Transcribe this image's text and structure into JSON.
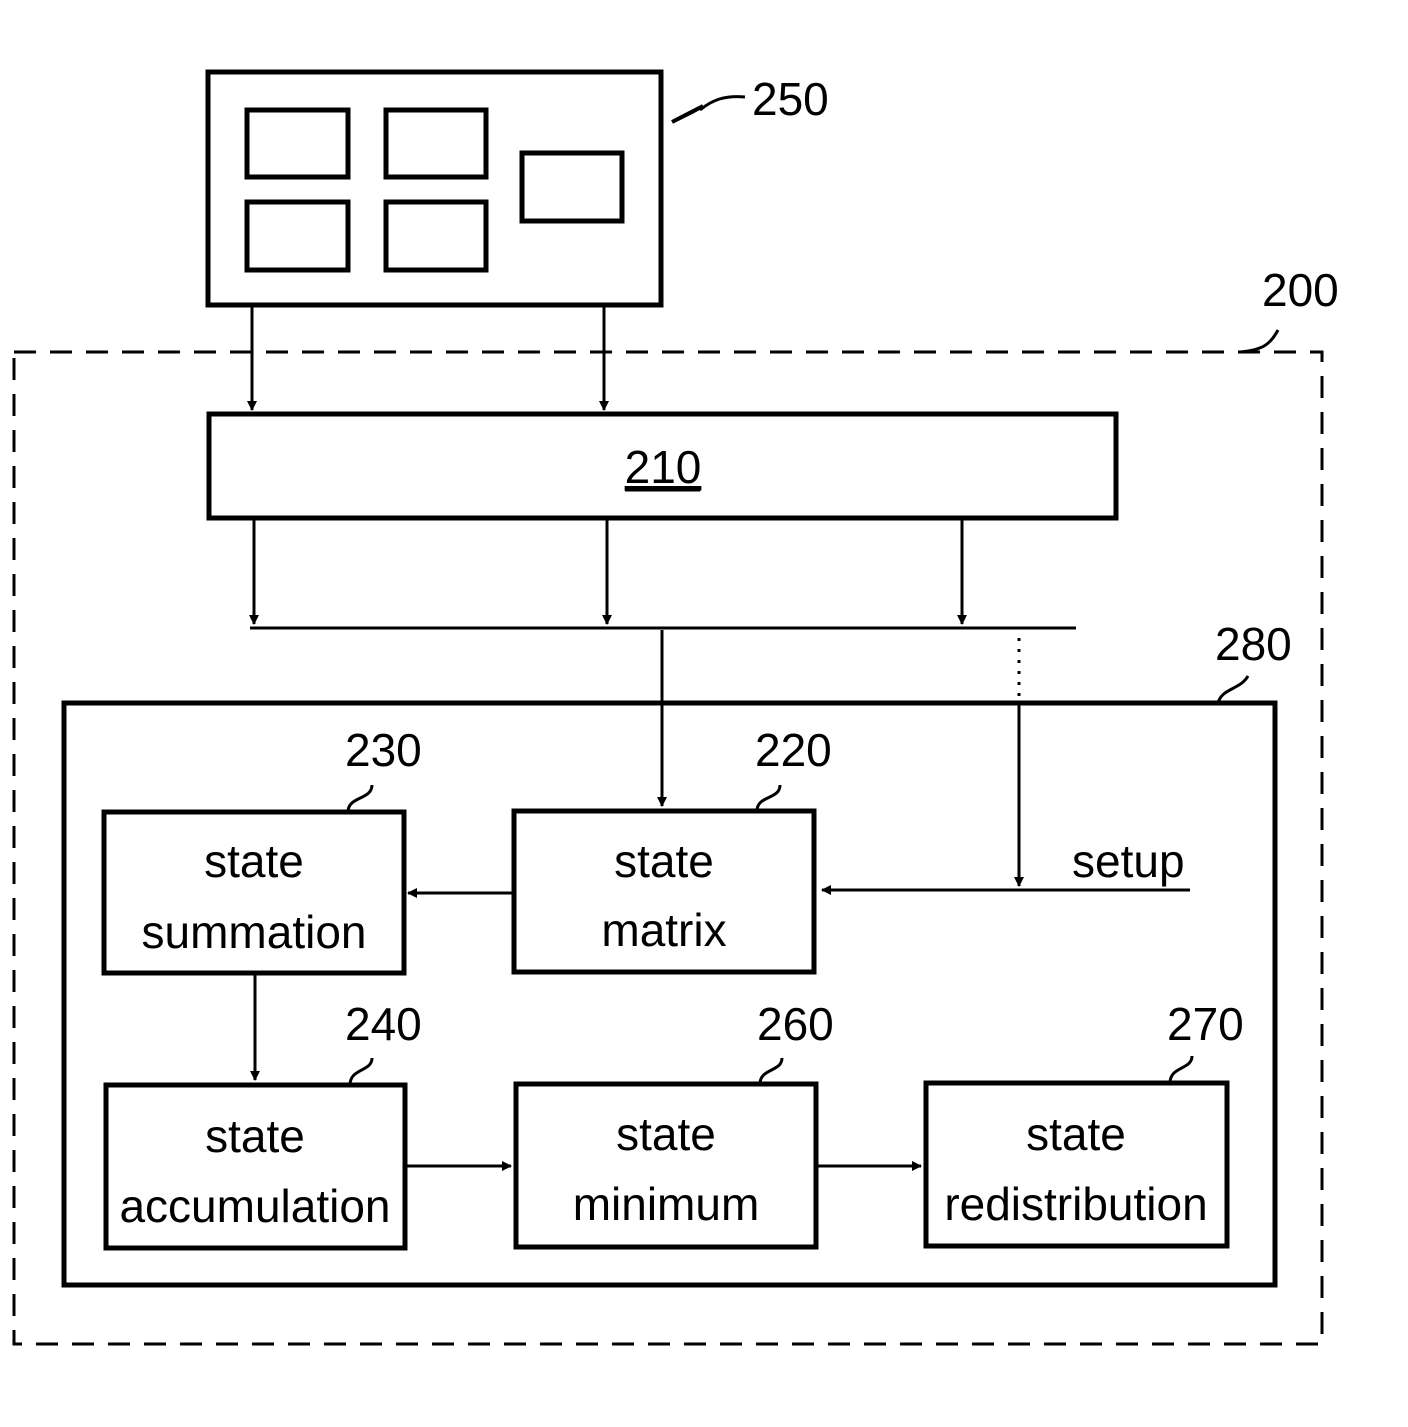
{
  "diagram": {
    "type": "block-diagram",
    "colors": {
      "stroke": "#000000",
      "background": "#ffffff"
    },
    "refs": {
      "input_device": "250",
      "system": "200",
      "bus_unit": "210",
      "processing_block": "280",
      "state_matrix": "220",
      "state_summation": "230",
      "state_accumulation": "240",
      "state_minimum": "260",
      "state_redistribution": "270"
    },
    "blocks": {
      "state_matrix": {
        "line1": "state",
        "line2": "matrix"
      },
      "state_summation": {
        "line1": "state",
        "line2": "summation"
      },
      "state_accumulation": {
        "line1": "state",
        "line2": "accumulation"
      },
      "state_minimum": {
        "line1": "state",
        "line2": "minimum"
      },
      "state_redistribution": {
        "line1": "state",
        "line2": "redistribution"
      }
    },
    "setup_label": "setup",
    "connections": [
      {
        "from": "250",
        "to": "210"
      },
      {
        "from": "250",
        "to": "210"
      },
      {
        "from": "210",
        "to": "bus"
      },
      {
        "from": "bus",
        "to": "220"
      },
      {
        "from": "setup",
        "to": "220"
      },
      {
        "from": "220",
        "to": "230"
      },
      {
        "from": "230",
        "to": "240"
      },
      {
        "from": "240",
        "to": "260"
      },
      {
        "from": "260",
        "to": "270"
      }
    ]
  }
}
